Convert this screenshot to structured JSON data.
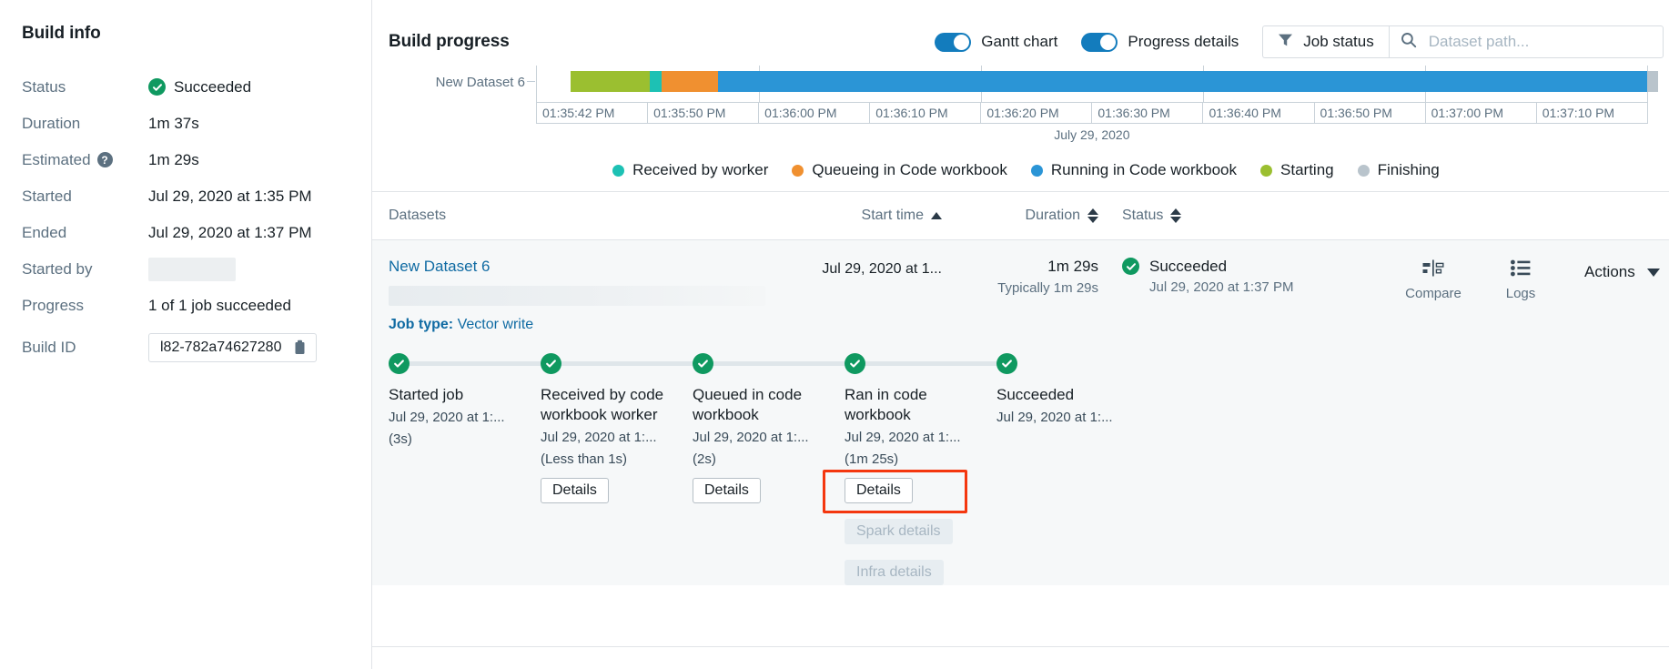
{
  "build_info": {
    "title": "Build info",
    "rows": [
      {
        "label": "Status",
        "value": "Succeeded",
        "type": "status"
      },
      {
        "label": "Duration",
        "value": "1m 37s",
        "type": "text"
      },
      {
        "label": "Estimated",
        "value": "1m 29s",
        "type": "help"
      },
      {
        "label": "Started",
        "value": "Jul 29, 2020 at 1:35 PM",
        "type": "text"
      },
      {
        "label": "Ended",
        "value": "Jul 29, 2020 at 1:37 PM",
        "type": "text"
      },
      {
        "label": "Started by",
        "value": "",
        "type": "redacted"
      },
      {
        "label": "Progress",
        "value": "1 of 1 job succeeded",
        "type": "text"
      },
      {
        "label": "Build ID",
        "value": "l82-782a74627280",
        "type": "copy"
      }
    ]
  },
  "progress": {
    "title": "Build progress",
    "toggles": [
      {
        "label": "Gantt chart",
        "on": true
      },
      {
        "label": "Progress details",
        "on": true
      }
    ],
    "job_status_button": "Job status",
    "search_placeholder": "Dataset path...",
    "search_value": ""
  },
  "chart_data": {
    "type": "bar",
    "orientation": "horizontal",
    "title": "Build progress",
    "categories": [
      "New Dataset 6"
    ],
    "axis_date": "July 29, 2020",
    "xlabel": "",
    "ylabel": "",
    "tick_labels": [
      "01:35:42 PM",
      "01:35:50 PM",
      "01:36:00 PM",
      "01:36:10 PM",
      "01:36:20 PM",
      "01:36:30 PM",
      "01:36:40 PM",
      "01:36:50 PM",
      "01:37:00 PM",
      "01:37:10 PM"
    ],
    "xlim": [
      "01:35:40 PM",
      "01:37:20 PM"
    ],
    "grid": true,
    "legend_position": "bottom",
    "legend": [
      {
        "name": "Received by worker",
        "color": "#1dc1b4"
      },
      {
        "name": "Queueing in Code workbook",
        "color": "#f09030"
      },
      {
        "name": "Running in Code workbook",
        "color": "#2b95d6"
      },
      {
        "name": "Starting",
        "color": "#9bbf30"
      },
      {
        "name": "Finishing",
        "color": "#b9c4cc"
      }
    ],
    "series": [
      {
        "name": "Starting",
        "color": "#9bbf30",
        "start_s": 3.0,
        "duration_s": 7.0
      },
      {
        "name": "Received by worker",
        "color": "#1dc1b4",
        "start_s": 10.0,
        "duration_s": 1.0
      },
      {
        "name": "Queueing in Code workbook",
        "color": "#f09030",
        "start_s": 11.0,
        "duration_s": 5.0
      },
      {
        "name": "Running in Code workbook",
        "color": "#2b95d6",
        "start_s": 16.0,
        "duration_s": 82.0
      },
      {
        "name": "Finishing",
        "color": "#b9c4cc",
        "start_s": 98.0,
        "duration_s": 1.0
      }
    ]
  },
  "table": {
    "headers": {
      "datasets": "Datasets",
      "start_time": "Start time",
      "duration": "Duration",
      "status": "Status"
    },
    "row": {
      "dataset": "New Dataset 6",
      "start_time": "Jul 29, 2020 at 1...",
      "duration": "1m 29s",
      "duration_sub": "Typically 1m 29s",
      "status": "Succeeded",
      "status_time": "Jul 29, 2020 at 1:37 PM",
      "compare_label": "Compare",
      "logs_label": "Logs",
      "actions_label": "Actions"
    },
    "job_type_label": "Job type:",
    "job_type_value": "Vector write",
    "stages": [
      {
        "title": "Started job",
        "time": "Jul 29, 2020 at 1:...",
        "duration": "(3s)",
        "buttons": []
      },
      {
        "title": "Received by code workbook worker",
        "time": "Jul 29, 2020 at 1:...",
        "duration": "(Less than 1s)",
        "buttons": [
          {
            "label": "Details",
            "enabled": true
          }
        ]
      },
      {
        "title": "Queued in code workbook",
        "time": "Jul 29, 2020 at 1:...",
        "duration": "(2s)",
        "buttons": [
          {
            "label": "Details",
            "enabled": true
          }
        ]
      },
      {
        "title": "Ran in code workbook",
        "time": "Jul 29, 2020 at 1:...",
        "duration": "(1m 25s)",
        "buttons": [
          {
            "label": "Details",
            "enabled": true
          },
          {
            "label": "Spark details",
            "enabled": false
          },
          {
            "label": "Infra details",
            "enabled": false
          }
        ]
      },
      {
        "title": "Succeeded",
        "time": "Jul 29, 2020 at 1:...",
        "duration": "",
        "buttons": []
      }
    ]
  },
  "colors": {
    "accent": "#137cbd",
    "link": "#106ba3",
    "success": "#0f9960",
    "highlight": "#f4370f",
    "muted": "#5c7080"
  }
}
